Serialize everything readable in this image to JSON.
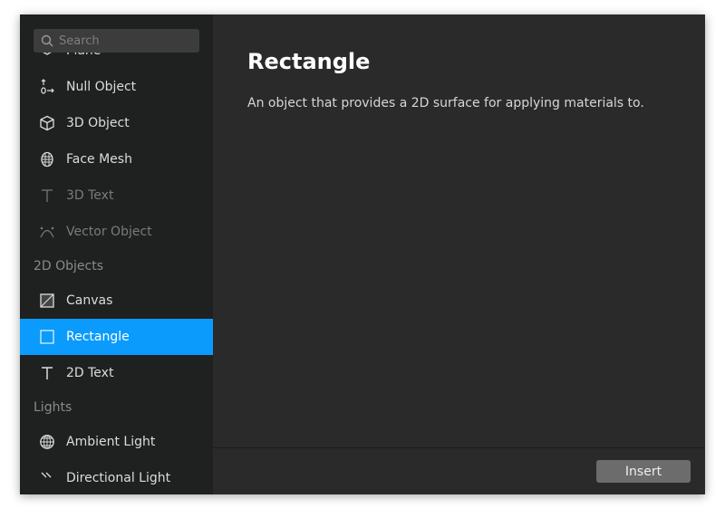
{
  "search": {
    "placeholder": "Search"
  },
  "sidebar": {
    "plane": "Plane",
    "null_object": "Null Object",
    "object_3d": "3D Object",
    "face_mesh": "Face Mesh",
    "text_3d": "3D Text",
    "vector_object": "Vector Object",
    "header_2d": "2D Objects",
    "canvas": "Canvas",
    "rectangle": "Rectangle",
    "text_2d": "2D Text",
    "header_lights": "Lights",
    "ambient_light": "Ambient Light",
    "directional_light": "Directional Light"
  },
  "detail": {
    "title": "Rectangle",
    "description": "An object that provides a 2D surface for applying materials to."
  },
  "footer": {
    "insert_label": "Insert"
  },
  "colors": {
    "selection": "#0a9bfc"
  }
}
